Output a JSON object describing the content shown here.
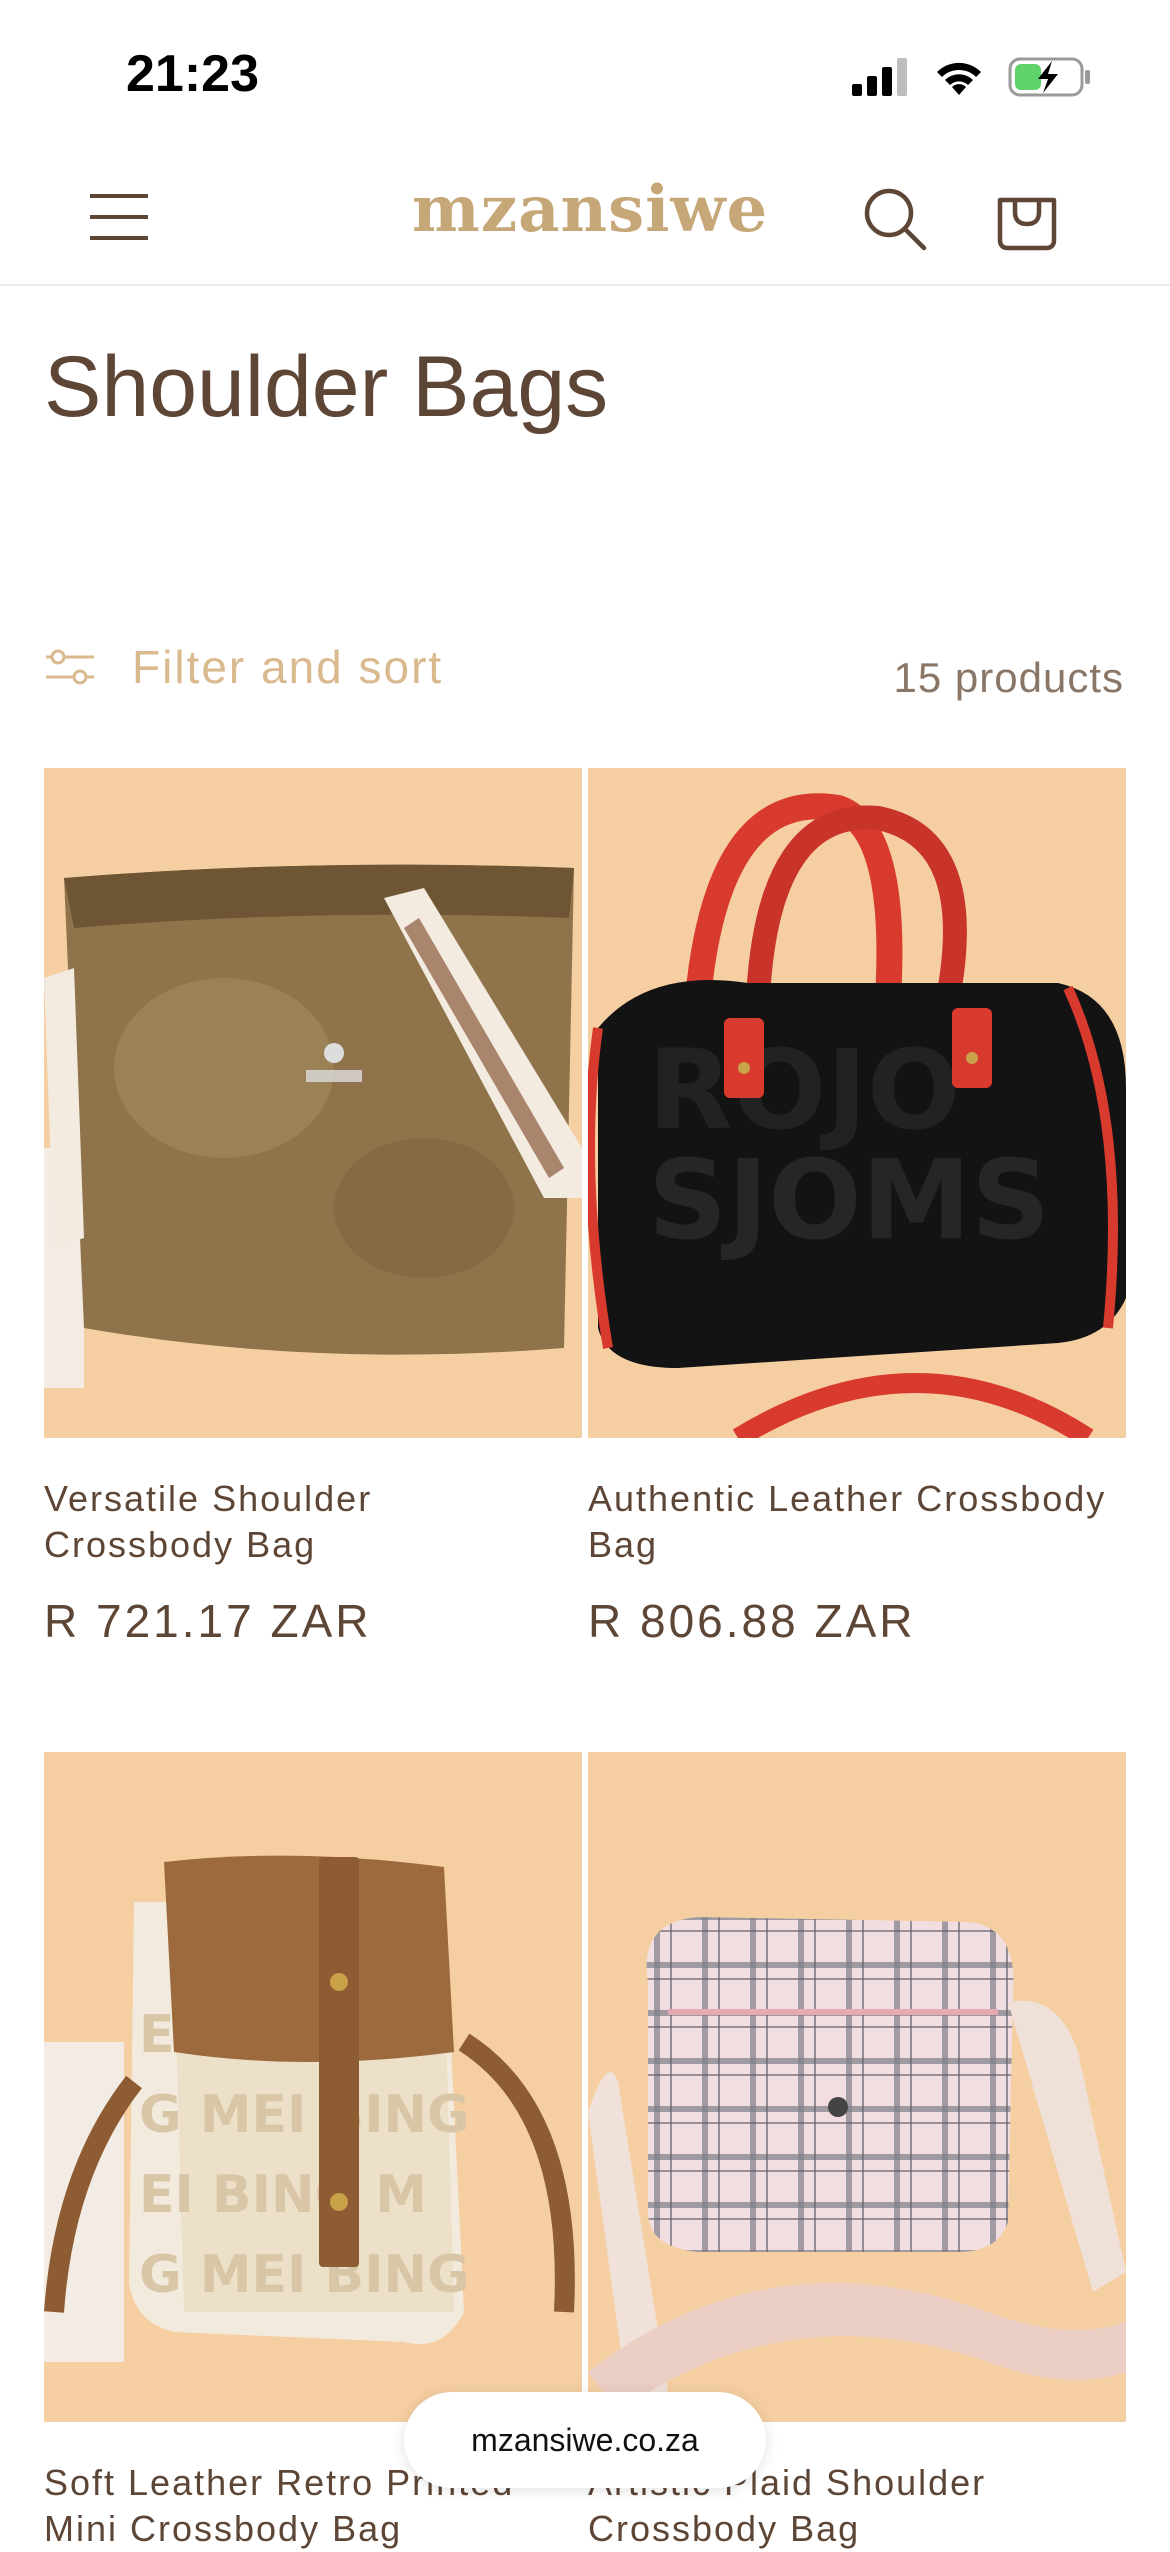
{
  "status_bar": {
    "time": "21:23",
    "icons": [
      "signal-icon",
      "wifi-icon",
      "battery-charging-icon"
    ]
  },
  "header": {
    "brand": "mzansiwe",
    "icons": [
      "menu-icon",
      "search-icon",
      "cart-icon"
    ]
  },
  "page": {
    "title": "Shoulder Bags"
  },
  "filter": {
    "label": "Filter and sort",
    "count": "15 products"
  },
  "products": [
    {
      "title": "Versatile Shoulder Crossbody Bag",
      "price": "R 721.17 ZAR"
    },
    {
      "title": "Authentic Leather Crossbody Bag",
      "price": "R 806.88 ZAR"
    },
    {
      "title": "Soft Leather Retro Printed Mini Crossbody Bag",
      "price": ""
    },
    {
      "title": "Artistic Plaid Shoulder Crossbody Bag",
      "price": ""
    }
  ],
  "browser": {
    "url": "mzansiwe.co.za"
  },
  "colors": {
    "accent": "#c6a777",
    "text": "#5e4636",
    "image_bg": "#f5cfa2",
    "filter_text": "#d9b98d"
  }
}
